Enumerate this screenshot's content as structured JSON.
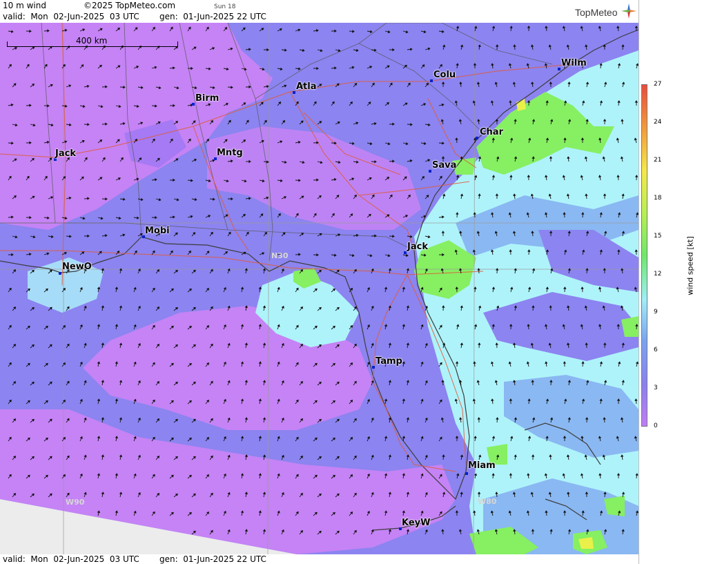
{
  "header": {
    "product": "10 m wind",
    "copyright": "©2025 TopMeteo.com",
    "sun": "Sun 18",
    "valid": "valid:  Mon  02-Jun-2025  03 UTC",
    "gen": "gen:  01-Jun-2025 22 UTC",
    "logo_text": "TopMeteo"
  },
  "footer": {
    "valid": "valid:  Mon  02-Jun-2025  03 UTC",
    "gen": "gen:  01-Jun-2025 22 UTC"
  },
  "map": {
    "scale_label": "400 km",
    "grid_labels": [
      "N30",
      "W90",
      "W80"
    ],
    "cities": [
      "Wilm",
      "Colu",
      "Atla",
      "Birm",
      "Char",
      "Jack",
      "Mntg",
      "Sava",
      "Mobi",
      "Jack",
      "NewO",
      "Tamp",
      "Miam",
      "KeyW"
    ],
    "zone_colors": {
      "calm": "#c583f5",
      "light": "#8c84f0",
      "moderate": "#aef3fa",
      "fresh": "#86ef62",
      "strong": "#e9f04a"
    }
  },
  "legend": {
    "title": "wind speed [kt]",
    "ticks": [
      "27",
      "24",
      "21",
      "18",
      "15",
      "12",
      "9",
      "6",
      "3",
      "0"
    ],
    "gradient": [
      "#e74c3c",
      "#f39c3c",
      "#f5e84a",
      "#b6ef54",
      "#6ee86a",
      "#a0eef8",
      "#7aa4f0",
      "#8b80ee",
      "#c07cf5"
    ]
  }
}
